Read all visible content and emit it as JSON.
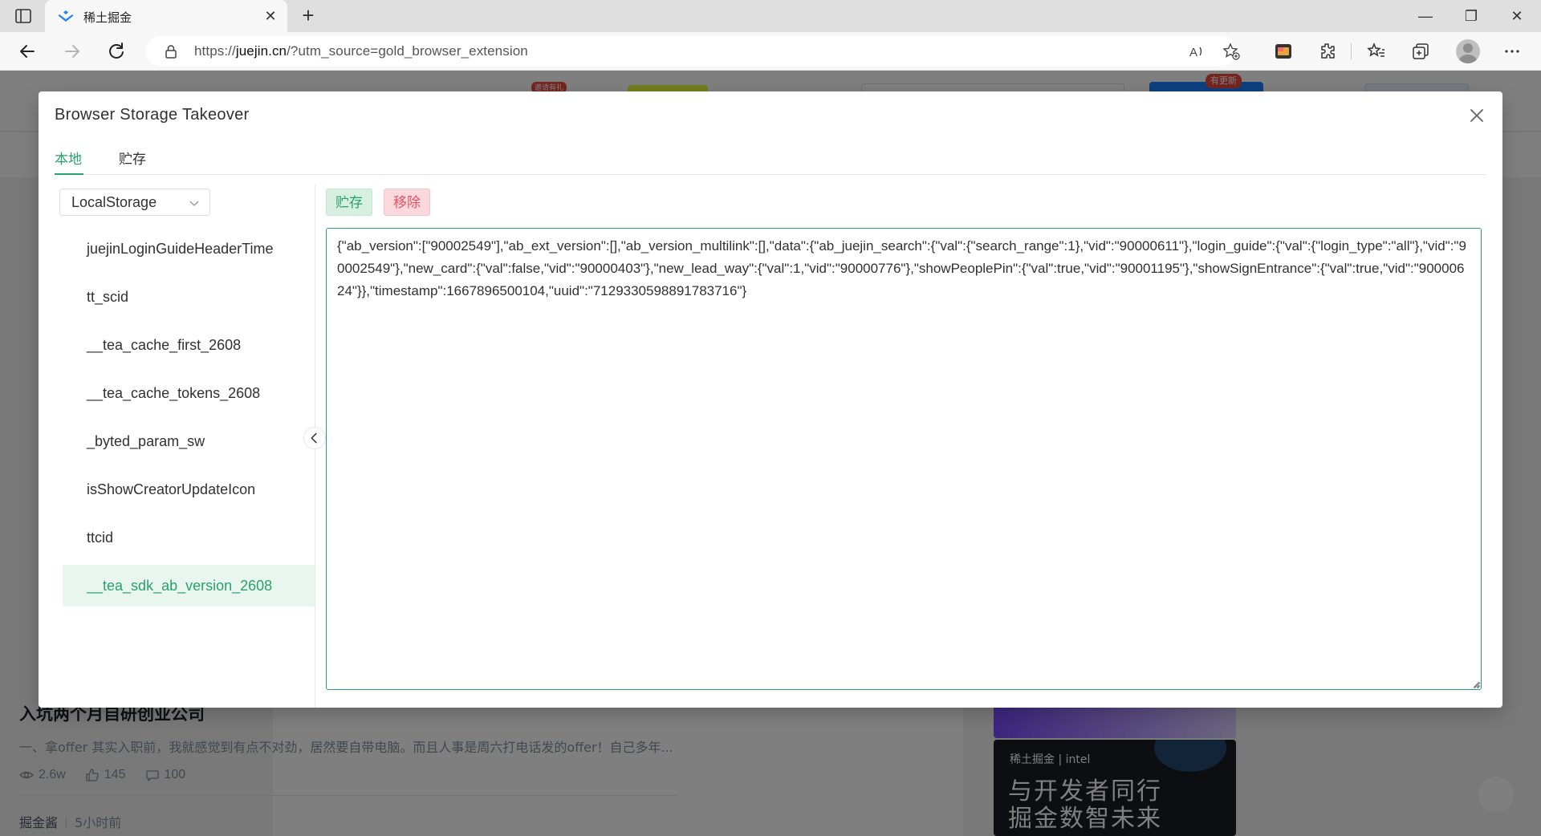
{
  "browser": {
    "tab_title": "稀土掘金",
    "url_prefix": "https://",
    "url_host": "juejin.cn",
    "url_rest": "/?utm_source=gold_browser_extension",
    "colors": {
      "tab_strip": "#dfdfdf",
      "toolbar": "#f7f7f7"
    }
  },
  "page": {
    "badge_small": "邀请有礼",
    "badge_update": "有更新",
    "article": {
      "title": "入坑两个月自研创业公司",
      "abstract": "一、拿offer 其实入职前，我就感觉到有点不对劲，居然要自带电脑。而且人事是周六打电话发的offer！自己多年...",
      "views": "2.6w",
      "likes": "145",
      "comments": "100",
      "author": "掘金酱",
      "time": "5小时前"
    },
    "banner": {
      "brand": "稀土掘金 | intel",
      "slogan_line1": "与开发者同行",
      "slogan_line2": "掘金数智未来"
    }
  },
  "modal": {
    "title": "Browser Storage Takeover",
    "tabs": [
      {
        "label": "本地",
        "active": true
      },
      {
        "label": "贮存",
        "active": false
      }
    ],
    "storage_select": {
      "value": "LocalStorage"
    },
    "keys": [
      "juejinLoginGuideHeaderTime",
      "tt_scid",
      "__tea_cache_first_2608",
      "__tea_cache_tokens_2608",
      "_byted_param_sw",
      "isShowCreatorUpdateIcon",
      "ttcid",
      "__tea_sdk_ab_version_2608"
    ],
    "selected_key": "__tea_sdk_ab_version_2608",
    "save_label": "贮存",
    "remove_label": "移除",
    "value": "{\"ab_version\":[\"90002549\"],\"ab_ext_version\":[],\"ab_version_multilink\":[],\"data\":{\"ab_juejin_search\":{\"val\":{\"search_range\":1},\"vid\":\"90000611\"},\"login_guide\":{\"val\":{\"login_type\":\"all\"},\"vid\":\"90002549\"},\"new_card\":{\"val\":false,\"vid\":\"90000403\"},\"new_lead_way\":{\"val\":1,\"vid\":\"90000776\"},\"showPeoplePin\":{\"val\":true,\"vid\":\"90001195\"},\"showSignEntrance\":{\"val\":true,\"vid\":\"90000624\"}},\"timestamp\":1667896500104,\"uuid\":\"7129330598891783716\"}",
    "colors": {
      "accent": "#2aa16c",
      "danger": "#e45563"
    }
  }
}
